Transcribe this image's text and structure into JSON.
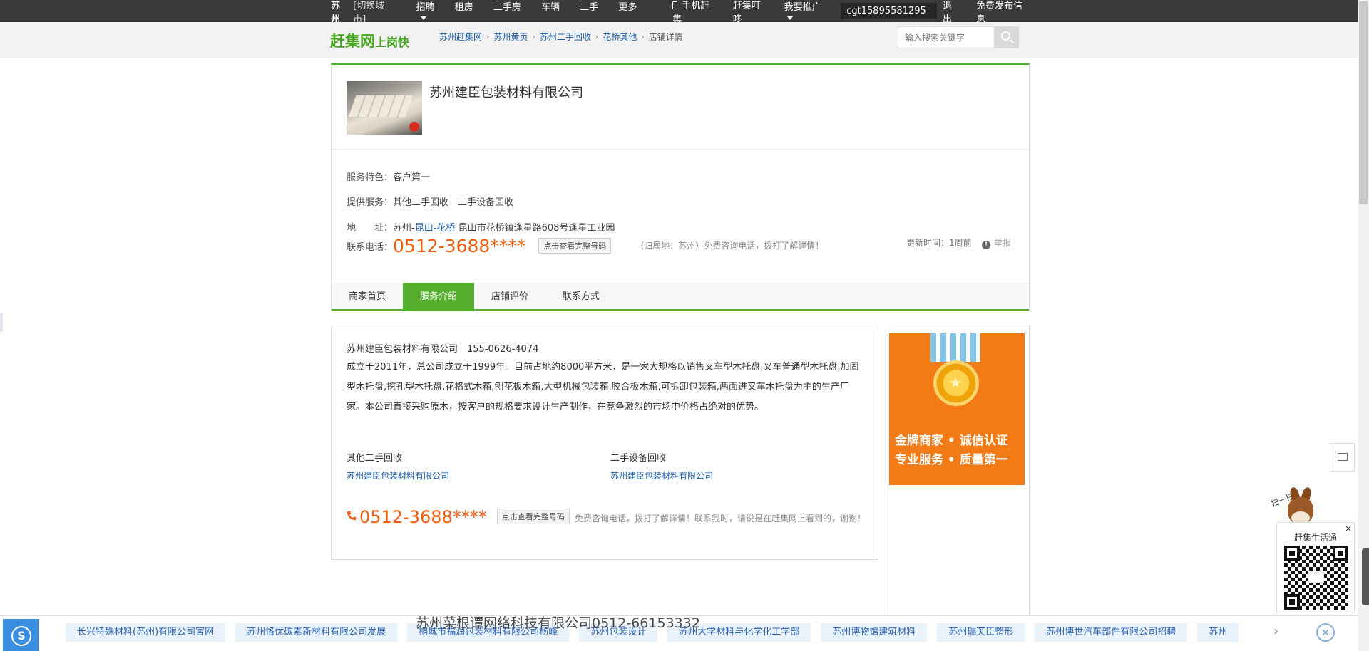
{
  "topbar": {
    "city": "苏州",
    "switch_city": "[切换城市]",
    "nav": [
      "招聘",
      "租房",
      "二手房",
      "车辆",
      "二手",
      "更多"
    ],
    "mobile": "手机赶集",
    "dingdong": "赶集叮咚",
    "promote": "我要推广",
    "user": "cgt15895581295",
    "logout": "退出",
    "free_post": "免费发布信息"
  },
  "header": {
    "logo_main": "赶集网",
    "logo_sub": "上岗快",
    "breadcrumb": [
      "苏州赶集网",
      "苏州黄页",
      "苏州二手回收",
      "花桥其他"
    ],
    "breadcrumb_current": "店铺详情",
    "search_placeholder": "输入搜索关键字"
  },
  "shop": {
    "name": "苏州建臣包装材料有限公司",
    "feature_label": "服务特色：",
    "feature_value": "客户第一",
    "services_label": "提供服务：",
    "services_value": "其他二手回收　二手设备回收",
    "address_label": "地　　址：",
    "address_city": "苏州-",
    "address_district": "昆山-花桥",
    "address_detail": "昆山市花桥镇逢星路608号逢星工业园",
    "phone_label": "联系电话：",
    "phone": "0512-3688****",
    "view_full": "点击查看完整号码",
    "owner_note": "（归属地：苏州）免费咨询电话，拨打了解详情！",
    "update_time": "更新时间：1周前",
    "report": "举报"
  },
  "tabs": [
    "商家首页",
    "服务介绍",
    "店铺评价",
    "联系方式"
  ],
  "intro": {
    "head": "苏州建臣包装材料有限公司　155-0626-4074",
    "description": "成立于2011年，总公司成立于1999年。目前占地约8000平方米，是一家大规格以销售叉车型木托盘,叉车普通型木托盘,加固型木托盘,挖孔型木托盘,花格式木箱,刨花板木箱,大型机械包装箱,胶合板木箱,可拆卸包装箱,两面进叉车木托盘为主的生产厂家。本公司直接采购原木，按客户的规格要求设计生产制作，在竞争激烈的市场中价格占绝对的优势。",
    "col1_title": "其他二手回收",
    "col1_link": "苏州建臣包装材料有限公司",
    "col2_title": "二手设备回收",
    "col2_link": "苏州建臣包装材料有限公司",
    "phone": "0512-3688****",
    "view_full": "点击查看完整号码",
    "note": "免费咨询电话，拨打了解详情！联系我时，请说是在赶集网上看到的，谢谢！"
  },
  "ad": {
    "line1": "金牌商家 • 诚信认证",
    "line2": "专业服务 • 质量第一"
  },
  "widgets": {
    "mascot_tag": "扫一扫",
    "qr_title": "赶集生活通",
    "qr_close": "×"
  },
  "bottom": {
    "company_line": "苏州菜根谭网络科技有限公司0512-66153332",
    "chips": [
      "长兴特殊材料(苏州)有限公司官网",
      "苏州恪优碳素新材料有限公司发展",
      "桐城市福润包装材料有限公司杨峰",
      "苏州包装设计",
      "苏州大学材料与化学化工学部",
      "苏州博物馆建筑材料",
      "苏州瑞芙臣整形",
      "苏州博世汽车部件有限公司招聘",
      "苏州"
    ],
    "next": "›",
    "close": "×"
  }
}
